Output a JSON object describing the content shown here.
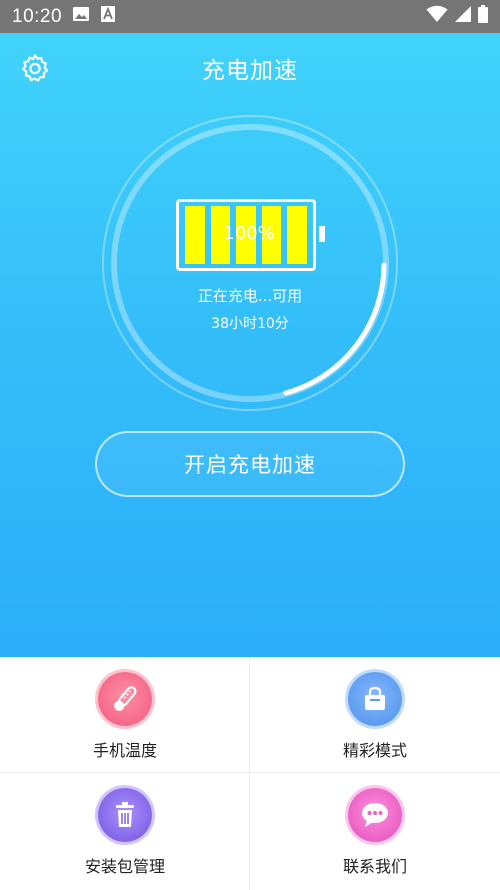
{
  "status_bar": {
    "time": "10:20",
    "icons": [
      "image-icon",
      "font-a-icon",
      "wifi-icon",
      "signal-icon",
      "battery-icon"
    ]
  },
  "header": {
    "title": "充电加速",
    "settings_icon": "gear-icon"
  },
  "charge": {
    "percent_label": "100%",
    "percent_value": 100,
    "battery_cells": 5,
    "status_text": "正在充电...可用",
    "remaining_time": "38小时10分"
  },
  "boost_button": {
    "label": "开启充电加速"
  },
  "menu": [
    {
      "label": "手机温度",
      "icon": "thermometer-icon",
      "color": "#f06a84"
    },
    {
      "label": "精彩模式",
      "icon": "shopping-bag-icon",
      "color": "#5e9ff0"
    },
    {
      "label": "安装包管理",
      "icon": "trash-icon",
      "color": "#8b6fe0"
    },
    {
      "label": "联系我们",
      "icon": "chat-bubble-icon",
      "color": "#ec69c7"
    }
  ],
  "colors": {
    "hero_top": "#41d3fb",
    "hero_bottom": "#2aaefa",
    "battery_fill": "#ffff00",
    "status_bar": "#757575"
  }
}
